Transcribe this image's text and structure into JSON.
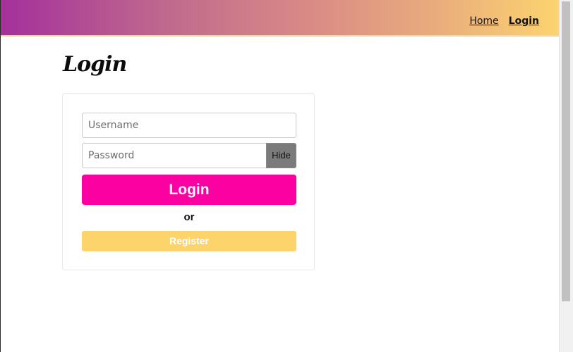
{
  "nav": {
    "links": [
      {
        "label": "Home",
        "active": false
      },
      {
        "label": "Login",
        "active": true
      }
    ],
    "gradient_colors": [
      "#a4309b",
      "#fcd46f"
    ]
  },
  "page": {
    "title": "Login"
  },
  "form": {
    "username": {
      "placeholder": "Username",
      "value": ""
    },
    "password": {
      "placeholder": "Password",
      "value": ""
    },
    "hide_label": "Hide",
    "login_label": "Login",
    "or_label": "or",
    "register_label": "Register"
  },
  "colors": {
    "login_button": "#fc01a2",
    "register_button": "#fdd46c",
    "hide_button": "#7b7b7b"
  }
}
